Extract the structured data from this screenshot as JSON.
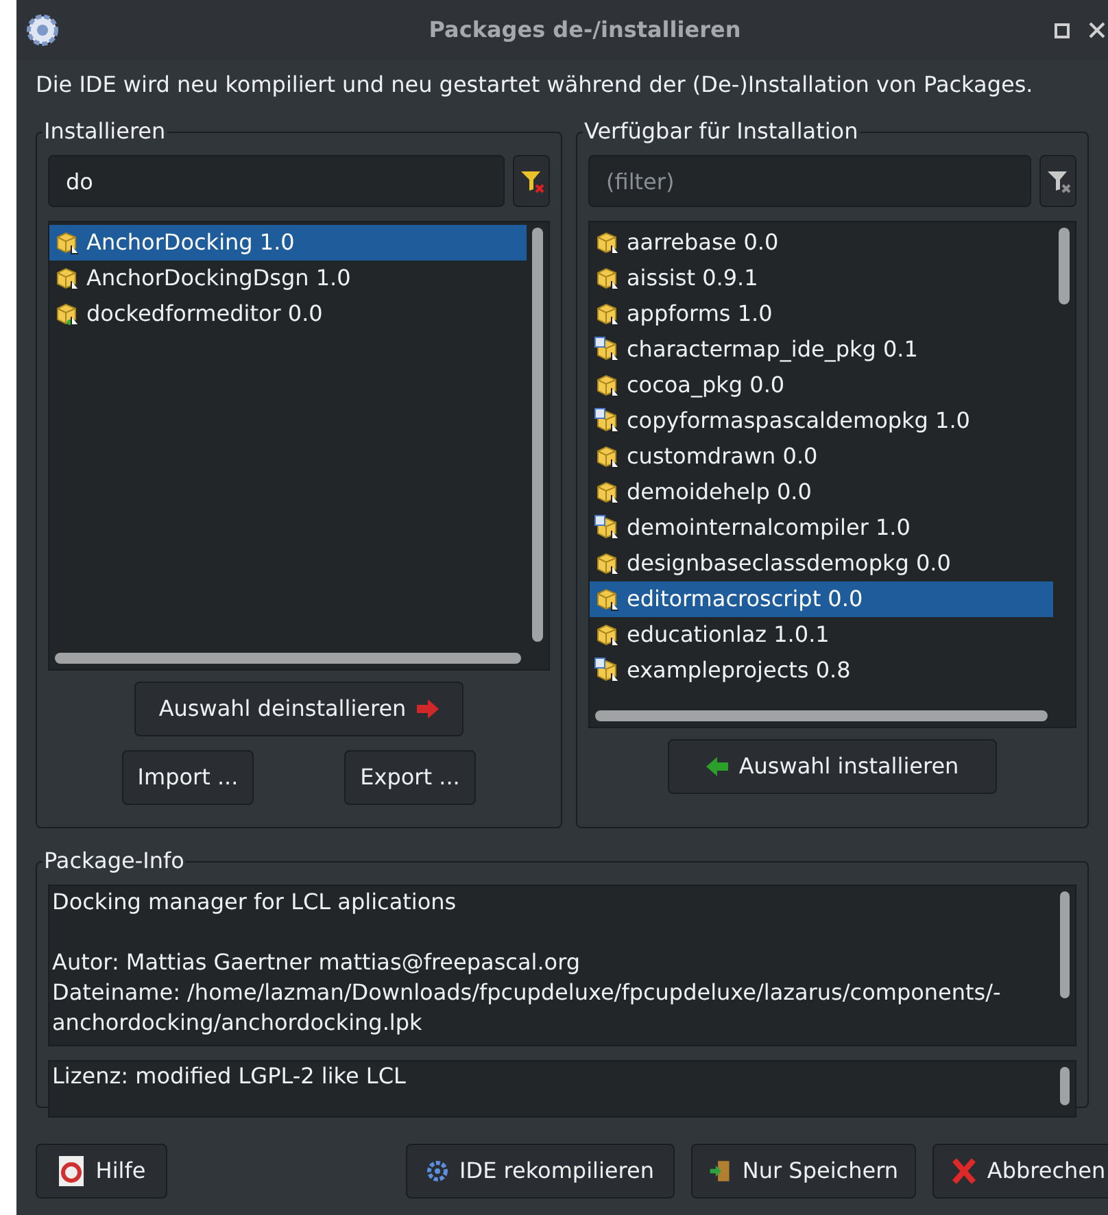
{
  "window": {
    "title": "Packages de-/installieren"
  },
  "description": "Die IDE wird neu kompiliert und neu gestartet während der (De-)Installation von Packages.",
  "installed": {
    "title": "Installieren",
    "filter": {
      "value": "do"
    },
    "items": [
      {
        "label": "AnchorDocking 1.0",
        "kind": "package",
        "selected": true
      },
      {
        "label": "AnchorDockingDsgn 1.0",
        "kind": "package",
        "selected": false
      },
      {
        "label": "dockedformeditor 0.0",
        "kind": "added",
        "selected": false
      }
    ],
    "uninstall_button": "Auswahl deinstallieren",
    "import_button": "Import ...",
    "export_button": "Export ..."
  },
  "available": {
    "title": "Verfügbar für Installation",
    "filter": {
      "placeholder": "(filter)"
    },
    "items": [
      {
        "label": "aarrebase 0.0",
        "kind": "package",
        "selected": false
      },
      {
        "label": "aissist 0.9.1",
        "kind": "package",
        "selected": false
      },
      {
        "label": "appforms 1.0",
        "kind": "package",
        "selected": false
      },
      {
        "label": "charactermap_ide_pkg 0.1",
        "kind": "grid",
        "selected": false
      },
      {
        "label": "cocoa_pkg 0.0",
        "kind": "package",
        "selected": false
      },
      {
        "label": "copyformaspascaldemopkg 1.0",
        "kind": "grid",
        "selected": false
      },
      {
        "label": "customdrawn 0.0",
        "kind": "package",
        "selected": false
      },
      {
        "label": "demoidehelp 0.0",
        "kind": "package",
        "selected": false
      },
      {
        "label": "demointernalcompiler 1.0",
        "kind": "grid",
        "selected": false
      },
      {
        "label": "designbaseclassdemopkg 0.0",
        "kind": "package",
        "selected": false
      },
      {
        "label": "editormacroscript 0.0",
        "kind": "package",
        "selected": true
      },
      {
        "label": "educationlaz 1.0.1",
        "kind": "package",
        "selected": false
      },
      {
        "label": "exampleprojects 0.8",
        "kind": "grid",
        "selected": false
      }
    ],
    "install_button": "Auswahl installieren"
  },
  "package_info": {
    "title": "Package-Info",
    "summary": "Docking manager for LCL aplications",
    "lines": [
      "Autor: Mattias Gaertner mattias@freepascal.org",
      "Dateiname: /home/lazman/Downloads/fpcupdeluxe/fpcupdeluxe/lazarus/components/-",
      "anchordocking/anchordocking.lpk"
    ],
    "license": "Lizenz: modified LGPL-2 like LCL"
  },
  "buttons": {
    "help": "Hilfe",
    "recompile": "IDE rekompilieren",
    "save": "Nur Speichern",
    "cancel": "Abbrechen"
  }
}
